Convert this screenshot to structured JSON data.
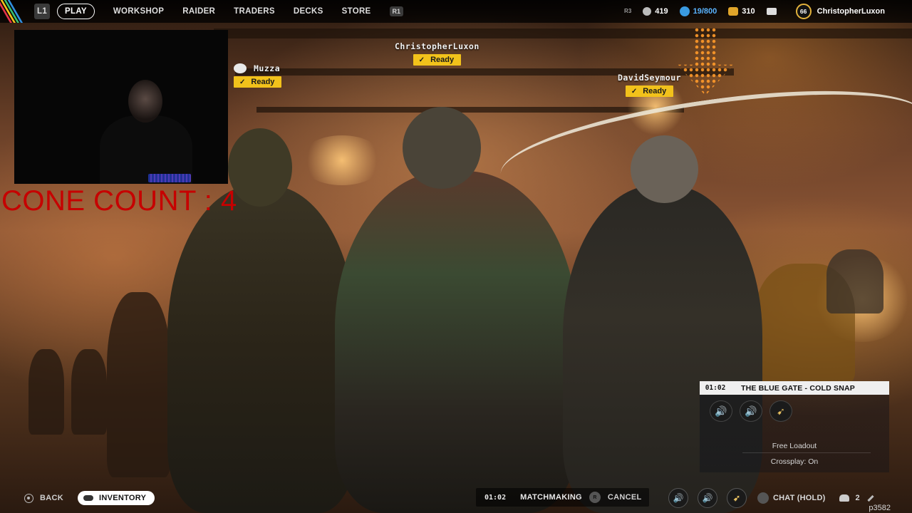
{
  "nav": {
    "left_hint": "L1",
    "right_hint": "R1",
    "items": [
      {
        "label": "PLAY",
        "active": true
      },
      {
        "label": "WORKSHOP",
        "active": false
      },
      {
        "label": "RAIDER",
        "active": false
      },
      {
        "label": "TRADERS",
        "active": false
      },
      {
        "label": "DECKS",
        "active": false
      },
      {
        "label": "STORE",
        "active": false
      }
    ]
  },
  "stats": {
    "r3_hint": "R3",
    "currency_1": "419",
    "currency_2": "19/800",
    "currency_3": "310",
    "level": "66",
    "username": "ChristopherLuxon"
  },
  "overlay": {
    "cone_count": "CONE COUNT : 4"
  },
  "players": [
    {
      "name": "Muzza",
      "status": "Ready",
      "leader": true
    },
    {
      "name": "ChristopherLuxon",
      "status": "Ready",
      "leader": false
    },
    {
      "name": "DavidSeymour",
      "status": "Ready",
      "leader": false
    }
  ],
  "map_panel": {
    "timer": "01:02",
    "title": "THE BLUE GATE - COLD SNAP",
    "free_loadout": "Free Loadout",
    "crossplay": "Crossplay: On",
    "slot_icons": [
      "speaker-icon",
      "speaker-icon",
      "raider-icon"
    ]
  },
  "bottom": {
    "back": "BACK",
    "inventory": "INVENTORY",
    "mm_time": "01:02",
    "matchmaking": "MATCHMAKING",
    "r_hint": "R",
    "cancel": "CANCEL",
    "chat": "CHAT (HOLD)",
    "party_count": "2"
  },
  "watermark": "p3582",
  "colors": {
    "accent_yellow": "#f2c21b",
    "level_ring": "#e3b23c",
    "cone_count_red": "#c60000"
  }
}
